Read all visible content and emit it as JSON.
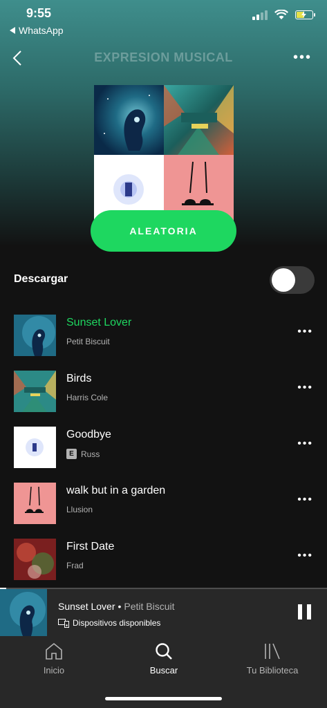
{
  "status_bar": {
    "time": "9:55",
    "back_app": "WhatsApp"
  },
  "header": {
    "title": "EXPRESION MUSICAL"
  },
  "shuffle_label": "ALEATORIA",
  "download": {
    "label": "Descargar",
    "enabled": false
  },
  "tracks": [
    {
      "title": "Sunset Lover",
      "artist": "Petit Biscuit",
      "playing": true,
      "explicit": false
    },
    {
      "title": "Birds",
      "artist": "Harris Cole",
      "playing": false,
      "explicit": false
    },
    {
      "title": "Goodbye",
      "artist": "Russ",
      "playing": false,
      "explicit": true,
      "explicit_badge": "E"
    },
    {
      "title": "walk but in a garden",
      "artist": "Llusion",
      "playing": false,
      "explicit": false
    },
    {
      "title": "First Date",
      "artist": "Frad",
      "playing": false,
      "explicit": false
    }
  ],
  "now_playing": {
    "title": "Sunset Lover",
    "separator": "•",
    "artist": "Petit Biscuit",
    "devices_label": "Dispositivos disponibles"
  },
  "tabs": [
    {
      "label": "Inicio",
      "icon": "home-icon",
      "active": false
    },
    {
      "label": "Buscar",
      "icon": "search-icon",
      "active": true
    },
    {
      "label": "Tu Biblioteca",
      "icon": "library-icon",
      "active": false
    }
  ],
  "colors": {
    "accent_green": "#1ed760",
    "background": "#121212",
    "hero_teal": "#3f8e8c",
    "player_bg": "#282828"
  }
}
